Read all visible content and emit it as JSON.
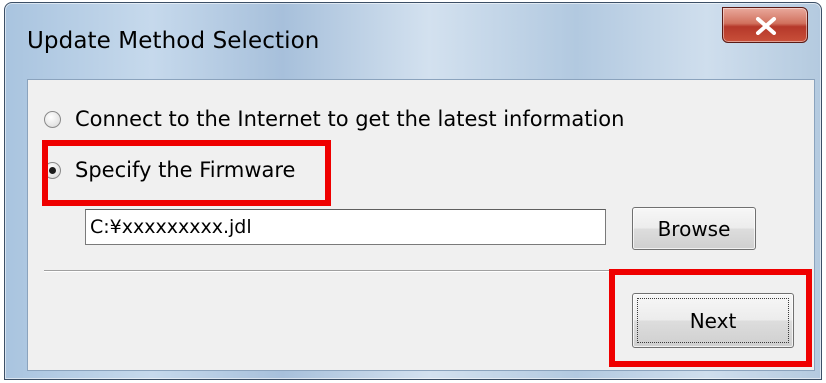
{
  "window": {
    "title": "Update Method Selection",
    "close_icon": "close-x-icon"
  },
  "options": [
    {
      "label": "Connect to the Internet to get the latest information",
      "selected": false
    },
    {
      "label": "Specify the Firmware",
      "selected": true
    }
  ],
  "firmware": {
    "path_value": "C:¥xxxxxxxxx.jdl",
    "browse_label": "Browse"
  },
  "footer": {
    "next_label": "Next"
  },
  "colors": {
    "highlight": "#ef0000",
    "dialog_background": "#f0f0f0",
    "close_button": "#c9503a"
  }
}
